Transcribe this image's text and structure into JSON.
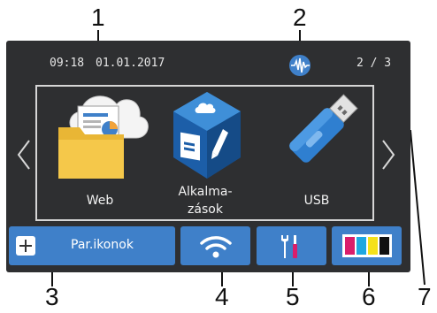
{
  "callouts": {
    "n1": "1",
    "n2": "2",
    "n3": "3",
    "n4": "4",
    "n5": "5",
    "n6": "6",
    "n7": "7"
  },
  "status_bar": {
    "time": "09:18",
    "date": "01.01.2017",
    "page_indicator": "2 / 3",
    "wireless_icon": "wireless-direct-icon"
  },
  "apps": [
    {
      "label_line1": "Web",
      "label_line2": "",
      "icon": "web-folder-cloud-icon"
    },
    {
      "label_line1": "Alkalma-",
      "label_line2": "zások",
      "icon": "apps-cube-icon"
    },
    {
      "label_line1": "USB",
      "label_line2": "",
      "icon": "usb-drive-icon"
    }
  ],
  "bottom_bar": {
    "shortcut_label": "Par.ikonok",
    "shortcut_icon": "plus-icon",
    "wifi_icon": "wifi-icon",
    "settings_icon": "settings-tools-icon",
    "ink_icon": "ink-cartridges-icon"
  },
  "colors": {
    "screen_bg": "#2e2f31",
    "button_blue": "#3f80c9",
    "ink_magenta": "#d91e6b",
    "ink_cyan": "#1ea7e1",
    "ink_yellow": "#f5e11a",
    "ink_black": "#111111"
  }
}
